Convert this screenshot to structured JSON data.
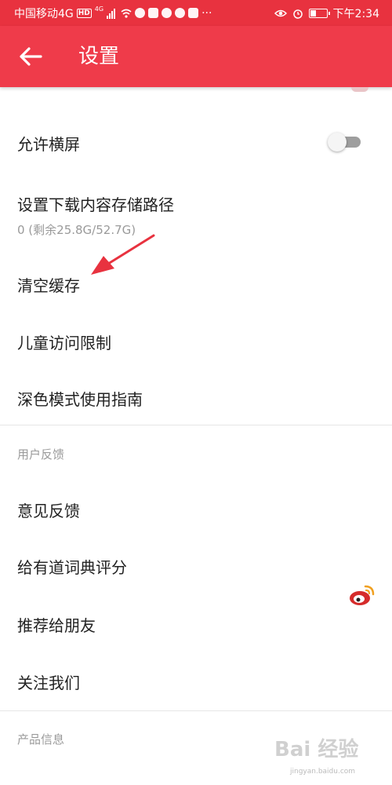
{
  "status_bar": {
    "carrier": "中国移动4G",
    "hd_badge": "HD",
    "signal_type": "4G",
    "time": "下午2:34",
    "battery_level": 0.35
  },
  "app_bar": {
    "title": "设置"
  },
  "settings": {
    "landscape": {
      "label": "允许横屏",
      "enabled": false
    },
    "storage_path": {
      "label": "设置下载内容存储路径",
      "detail": "0 (剩余25.8G/52.7G)"
    },
    "clear_cache": {
      "label": "清空缓存"
    },
    "child_limit": {
      "label": "儿童访问限制"
    },
    "dark_mode": {
      "label": "深色模式使用指南"
    }
  },
  "feedback_section": {
    "header": "用户反馈",
    "feedback": "意见反馈",
    "rate": "给有道词典评分",
    "recommend": "推荐给朋友",
    "follow": "关注我们"
  },
  "product_section": {
    "header": "产品信息"
  },
  "watermark": {
    "text": "Bai 经验",
    "url": "jingyan.baidu.com"
  },
  "colors": {
    "status_bar": "#e8323f",
    "app_bar": "#ef3b4a",
    "annotation_arrow": "#e8323f",
    "weibo_red": "#d52c2b"
  },
  "icons": {
    "back": "arrow-left-icon",
    "weibo": "weibo-icon",
    "annotation": "red-pointer-arrow"
  }
}
